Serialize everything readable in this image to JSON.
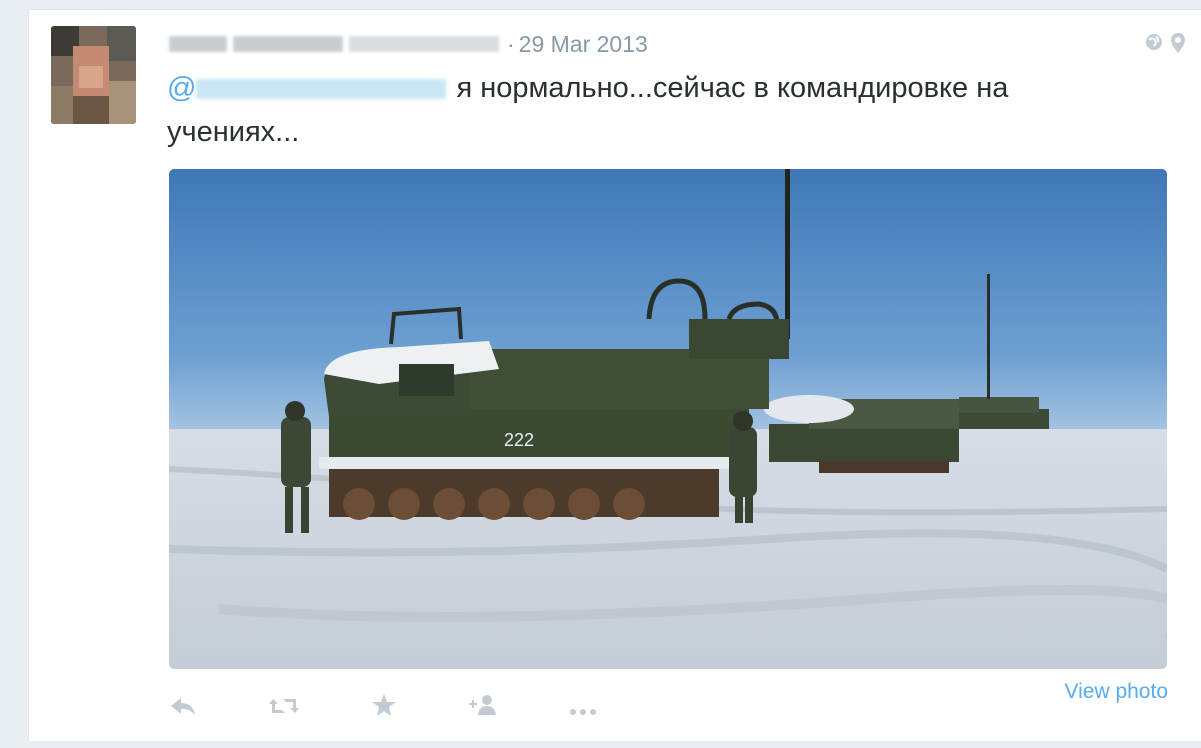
{
  "tweet": {
    "date": "29 Mar 2013",
    "separator": "·",
    "mention_prefix": "@",
    "text_line1": "я нормально...сейчас в командировке на",
    "text_line2": "учениях...",
    "photo_vehicle_number": "222"
  },
  "actions": {
    "reply_icon": "reply-icon",
    "retweet_icon": "retweet-icon",
    "favorite_icon": "star-icon",
    "follow_icon": "follow-user-icon",
    "more_icon": "more-icon",
    "view_photo_label": "View photo"
  },
  "colors": {
    "link": "#55acee",
    "text": "#292f33",
    "meta": "#8899a6"
  }
}
